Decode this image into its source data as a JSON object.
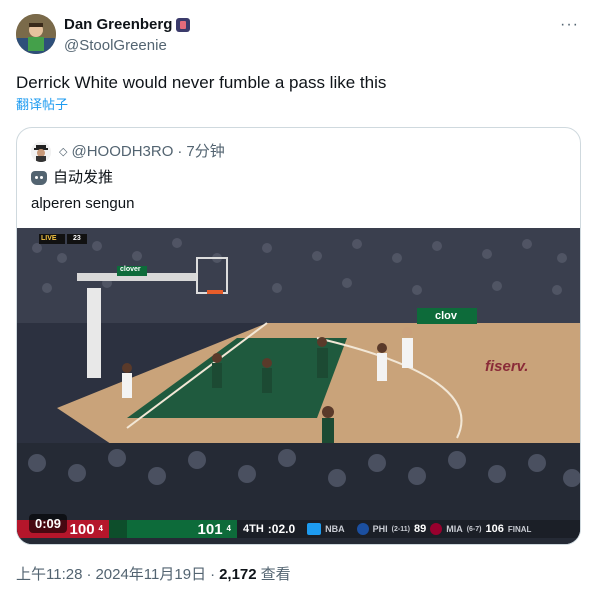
{
  "author": {
    "name": "Dan Greenberg",
    "handle": "@StoolGreenie"
  },
  "tweet": {
    "text": "Derrick White would never fumble a pass like this",
    "translate_label": "翻译帖子"
  },
  "quoted": {
    "handle": "@HOODH3RO",
    "separator": "·",
    "time": "7分钟",
    "auto_label": "自动发推",
    "text": "alperen sengun"
  },
  "video": {
    "timer": "0:09",
    "court_ads": [
      "fiserv.",
      "clov",
      "clover"
    ],
    "scorebug": {
      "home_score": "100",
      "home_fouls": "4",
      "away_score": "101",
      "away_fouls": "4",
      "period": "4TH",
      "clock": ":02.0",
      "league": "NBA",
      "other_game_team1": "PHI",
      "other_game_team1_record": "(2-11)",
      "other_game_score1": "89",
      "other_game_team2": "MIA",
      "other_game_team2_record": "(6-7)",
      "other_game_score2": "106",
      "other_game_status": "FINAL",
      "live_label": "LIVE",
      "live_number": "23"
    }
  },
  "footer": {
    "time": "上午11:28",
    "dot": "·",
    "date": "2024年11月19日",
    "dot2": "·",
    "views": "2,172",
    "views_label": "查看"
  },
  "colors": {
    "link": "#1d9bf0",
    "secondary_text": "#536471",
    "border": "#cfd9de",
    "bucks_green": "#0d6b3a",
    "home_red": "#b5162b"
  }
}
